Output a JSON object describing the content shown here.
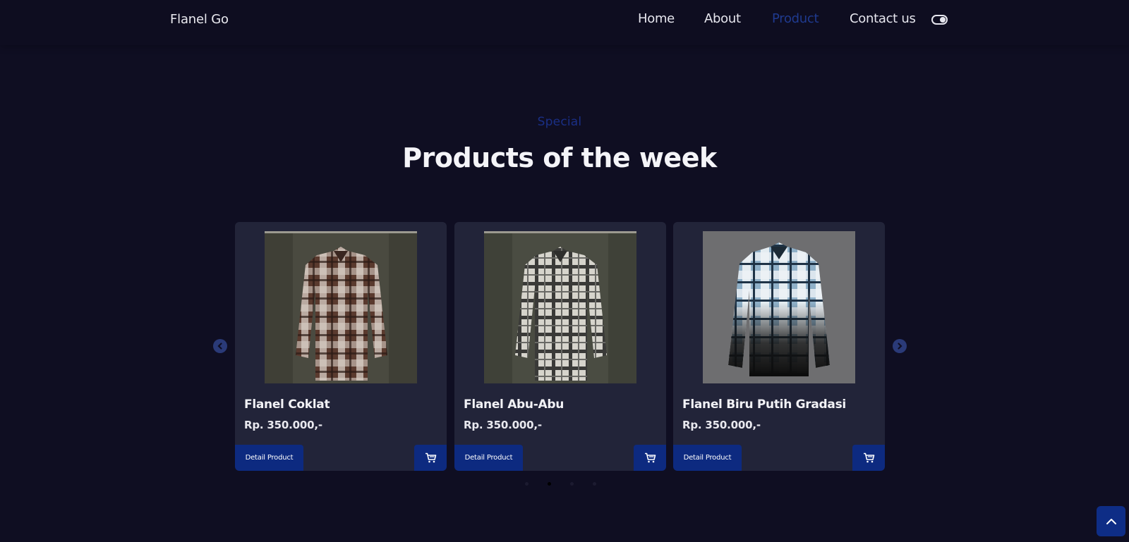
{
  "header": {
    "brand": "Flanel Go",
    "nav": [
      {
        "label": "Home",
        "active": false
      },
      {
        "label": "About",
        "active": false
      },
      {
        "label": "Product",
        "active": true
      },
      {
        "label": "Contact us",
        "active": false
      }
    ],
    "theme_toggle_icon": "toggle-icon"
  },
  "section": {
    "subtitle": "Special",
    "title": "Products of the week"
  },
  "carousel": {
    "prev_icon": "chevron-left-icon",
    "next_icon": "chevron-right-icon",
    "products": [
      {
        "name": "Flanel Coklat",
        "price": "Rp. 350.000,-",
        "detail_label": "Detail Product",
        "cart_icon": "cart-icon"
      },
      {
        "name": "Flanel Abu-Abu",
        "price": "Rp. 350.000,-",
        "detail_label": "Detail Product",
        "cart_icon": "cart-icon"
      },
      {
        "name": "Flanel Biru Putih Gradasi",
        "price": "Rp. 350.000,-",
        "detail_label": "Detail Product",
        "cart_icon": "cart-icon"
      }
    ],
    "dots": 4,
    "active_dot": 2
  },
  "scroll_top_icon": "chevron-up-icon",
  "colors": {
    "background": "#0f0e22",
    "card": "#222439",
    "accent": "#0d2a80",
    "active_nav": "#1f3a8f"
  }
}
